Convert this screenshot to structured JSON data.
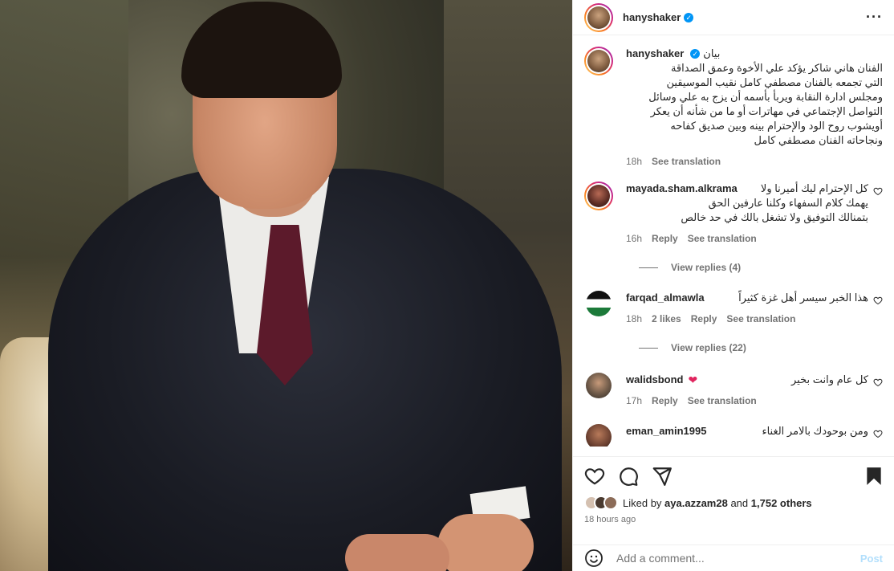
{
  "post": {
    "username": "hanyshaker",
    "verified": true,
    "caption_label": "بيان",
    "caption": [
      "الفنان هاني شاكر يؤكد علي الأخوة وعمق الصداقة",
      "التي تجمعه بالفنان مصطفي كامل نقيب الموسيقين",
      "ومجلس ادارة النقابة ويربأ بأسمه أن يزج به علي وسائل",
      "التواصل الإجتماعي في مهاترات أو ما من شأنه أن يعكر",
      "أويشوب روح الود والإحترام بينه وبين صديق كفاحه",
      "ونجاحاته الفنان مصطفي كامل"
    ],
    "caption_time": "18h",
    "see_translation": "See translation",
    "liked_by_prefix": "Liked by",
    "liked_by_user": "aya.azzam28",
    "liked_by_and": "and",
    "liked_by_others": "1,752 others",
    "time_ago": "18 hours ago",
    "add_comment_placeholder": "Add a comment...",
    "post_label": "Post"
  },
  "comments": [
    {
      "username": "mayada.sham.alkrama",
      "text": [
        "كل الإحترام ليك أميرنا ولا",
        "يهمك كلام السفهاء وكلنا عارفين الحق",
        "بتمنالك التوفيق ولا تشغل بالك في حد خالص"
      ],
      "time": "16h",
      "likes": "",
      "reply": "Reply",
      "see_translation": "See translation",
      "view_replies": "View replies (4)"
    },
    {
      "username": "farqad_almawla",
      "text": [
        "هذا الخبر سيسر أهل غزة كثيراً"
      ],
      "time": "18h",
      "likes": "2 likes",
      "reply": "Reply",
      "see_translation": "See translation",
      "view_replies": "View replies (22)"
    },
    {
      "username": "walidsbond",
      "text": [
        "كل عام وانت بخير"
      ],
      "time": "17h",
      "likes": "",
      "reply": "Reply",
      "see_translation": "See translation",
      "view_replies": ""
    },
    {
      "username": "eman_amin1995",
      "text": [
        "ومن بوحودك بالامر الغناء"
      ],
      "time": "",
      "likes": "",
      "reply": "",
      "see_translation": "",
      "view_replies": ""
    }
  ],
  "icons": {
    "like": "heart-icon",
    "comment": "comment-icon",
    "share": "share-icon",
    "save": "bookmark-icon",
    "more": "more-icon",
    "emoji": "emoji-icon"
  },
  "colors": {
    "accent": "#0095f6",
    "post_disabled": "#b2dffc",
    "muted": "#737373",
    "heart_red": "#e0245e"
  }
}
